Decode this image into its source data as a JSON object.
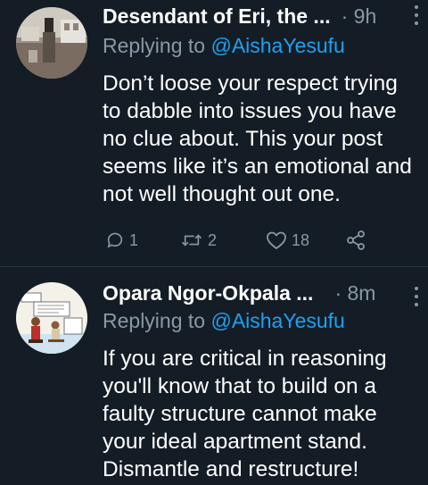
{
  "tweets": [
    {
      "author_name": "Desendant of Eri, the ...",
      "separator": "·",
      "time": "9h",
      "reply_prefix": "Replying to ",
      "reply_handle": "@AishaYesufu",
      "text": "Don’t loose your respect trying to dabble into issues you have no clue about. This your post seems like it’s an emotional and not well thought out one.",
      "replies": "1",
      "retweets": "2",
      "likes": "18"
    },
    {
      "author_name": "Opara Ngor-Okpala ...",
      "separator": "·",
      "time": "8m",
      "reply_prefix": "Replying to ",
      "reply_handle": "@AishaYesufu",
      "text": "If you are critical in reasoning you'll know that to build on a faulty structure cannot make your ideal apartment stand. Dismantle and restructure!"
    }
  ],
  "icons": {
    "reply": "reply-icon",
    "retweet": "retweet-icon",
    "like": "heart-icon",
    "share": "share-icon",
    "more": "more-vertical-icon"
  },
  "colors": {
    "background": "#141d26",
    "secondary_text": "#8899a6",
    "link": "#1da1f2",
    "divider": "#2b3742"
  }
}
